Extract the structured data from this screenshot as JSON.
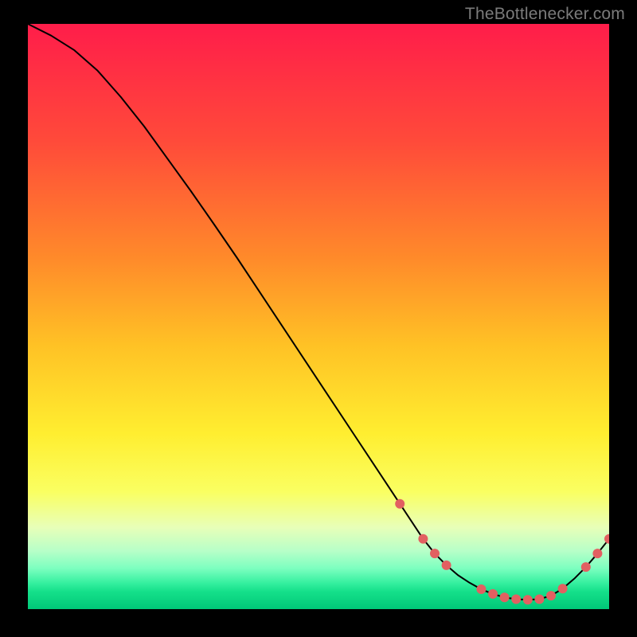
{
  "watermark": "TheBottlenecker.com",
  "chart_data": {
    "type": "line",
    "title": "",
    "xlabel": "",
    "ylabel": "",
    "xlim": [
      0,
      100
    ],
    "ylim": [
      0,
      100
    ],
    "x": [
      0,
      4,
      8,
      12,
      16,
      20,
      24,
      28,
      32,
      36,
      40,
      44,
      48,
      52,
      56,
      60,
      64,
      68,
      70,
      72,
      74,
      76,
      78,
      80,
      82,
      84,
      86,
      88,
      90,
      92,
      94,
      96,
      98,
      100
    ],
    "y": [
      100,
      98,
      95.5,
      92,
      87.5,
      82.5,
      77,
      71.5,
      65.8,
      60,
      54,
      48,
      42,
      36,
      30,
      24,
      18,
      12,
      9.5,
      7.5,
      5.8,
      4.5,
      3.4,
      2.6,
      2.0,
      1.7,
      1.6,
      1.7,
      2.3,
      3.5,
      5.2,
      7.2,
      9.5,
      12
    ],
    "marker_idx": [
      16,
      17,
      18,
      19,
      22,
      23,
      24,
      25,
      26,
      27,
      28,
      29,
      31,
      32,
      33
    ],
    "gradient_stops": [
      {
        "pct": 0,
        "color": "#ff1d4a"
      },
      {
        "pct": 20,
        "color": "#ff4a3a"
      },
      {
        "pct": 40,
        "color": "#ff8a2a"
      },
      {
        "pct": 55,
        "color": "#ffc225"
      },
      {
        "pct": 70,
        "color": "#ffee30"
      },
      {
        "pct": 80,
        "color": "#faff62"
      },
      {
        "pct": 86,
        "color": "#e8ffb8"
      },
      {
        "pct": 90,
        "color": "#b8ffc8"
      },
      {
        "pct": 93,
        "color": "#7dffc0"
      },
      {
        "pct": 95.5,
        "color": "#36f0a0"
      },
      {
        "pct": 97,
        "color": "#15e08a"
      },
      {
        "pct": 100,
        "color": "#00c878"
      }
    ],
    "line_color": "#000000",
    "marker_color": "#e26061",
    "marker_radius": 6
  }
}
